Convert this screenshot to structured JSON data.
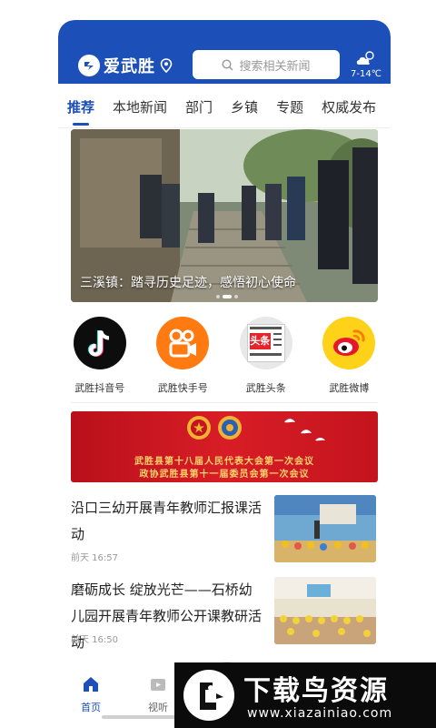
{
  "brand": {
    "name": "爱武胜"
  },
  "search": {
    "placeholder": "搜索相关新闻"
  },
  "weather": {
    "temp": "7-14℃",
    "icon": "cloudy-icon"
  },
  "tabs": [
    {
      "label": "推荐",
      "active": true
    },
    {
      "label": "本地新闻"
    },
    {
      "label": "部门"
    },
    {
      "label": "乡镇"
    },
    {
      "label": "专题"
    },
    {
      "label": "权威发布"
    }
  ],
  "banner": {
    "caption": "三溪镇：踏寻历史足迹，感悟初心使命",
    "page_count": 3,
    "current_page": 2
  },
  "apps": [
    {
      "label": "武胜抖音号",
      "icon": "douyin-icon"
    },
    {
      "label": "武胜快手号",
      "icon": "kuaishou-icon"
    },
    {
      "label": "武胜头条",
      "icon": "toutiao-icon",
      "icon_text": "头条"
    },
    {
      "label": "武胜微博",
      "icon": "weibo-icon"
    }
  ],
  "ad": {
    "line1": "武胜县第十八届人民代表大会第一次会议",
    "line2": "政协武胜县第十一届委员会第一次会议"
  },
  "news": [
    {
      "title": "沿口三幼开展青年教师汇报课活动",
      "time": "前天 16:57"
    },
    {
      "title": "磨砺成长 绽放光芒——石桥幼儿园开展青年教师公开课教研活动",
      "time": "前天 16:50"
    }
  ],
  "bottom_nav": [
    {
      "label": "首页",
      "active": true
    },
    {
      "label": "视听"
    }
  ],
  "watermark": {
    "title": "下载鸟资源",
    "url": "www.xiazainiao.com"
  },
  "colors": {
    "primary": "#1d4fb8",
    "ad_red": "#c4141e"
  }
}
